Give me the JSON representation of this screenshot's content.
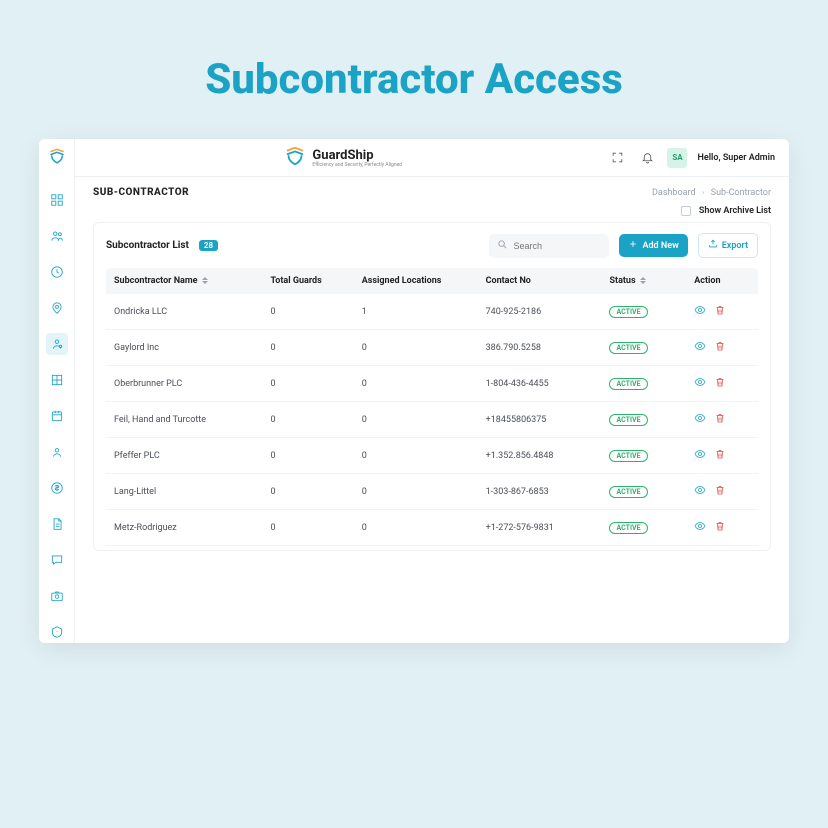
{
  "hero": "Subcontractor Access",
  "brand": {
    "name": "GuardShip",
    "tagline": "Efficiency and Security, Perfectly Aligned"
  },
  "user": {
    "initials": "SA",
    "greeting": "Hello, Super Admin"
  },
  "page": {
    "title": "SUB-CONTRACTOR"
  },
  "breadcrumb": {
    "root": "Dashboard",
    "current": "Sub-Contractor"
  },
  "archive": {
    "label": "Show Archive List"
  },
  "list": {
    "title": "Subcontractor List",
    "count": "28"
  },
  "search": {
    "placeholder": "Search"
  },
  "buttons": {
    "add": "Add New",
    "export": "Export"
  },
  "columns": {
    "name": "Subcontractor Name",
    "guards": "Total Guards",
    "locations": "Assigned Locations",
    "contact": "Contact No",
    "status": "Status",
    "action": "Action"
  },
  "status_active": "ACTIVE",
  "rows": [
    {
      "name": "Ondricka LLC",
      "guards": "0",
      "locations": "1",
      "contact": "740-925-2186",
      "status": "ACTIVE"
    },
    {
      "name": "Gaylord Inc",
      "guards": "0",
      "locations": "0",
      "contact": "386.790.5258",
      "status": "ACTIVE"
    },
    {
      "name": "Oberbrunner PLC",
      "guards": "0",
      "locations": "0",
      "contact": "1-804-436-4455",
      "status": "ACTIVE"
    },
    {
      "name": "Feil, Hand and Turcotte",
      "guards": "0",
      "locations": "0",
      "contact": "+18455806375",
      "status": "ACTIVE"
    },
    {
      "name": "Pfeffer PLC",
      "guards": "0",
      "locations": "0",
      "contact": "+1.352.856.4848",
      "status": "ACTIVE"
    },
    {
      "name": "Lang-Littel",
      "guards": "0",
      "locations": "0",
      "contact": "1-303-867-6853",
      "status": "ACTIVE"
    },
    {
      "name": "Metz-Rodriguez",
      "guards": "0",
      "locations": "0",
      "contact": "+1-272-576-9831",
      "status": "ACTIVE"
    }
  ]
}
